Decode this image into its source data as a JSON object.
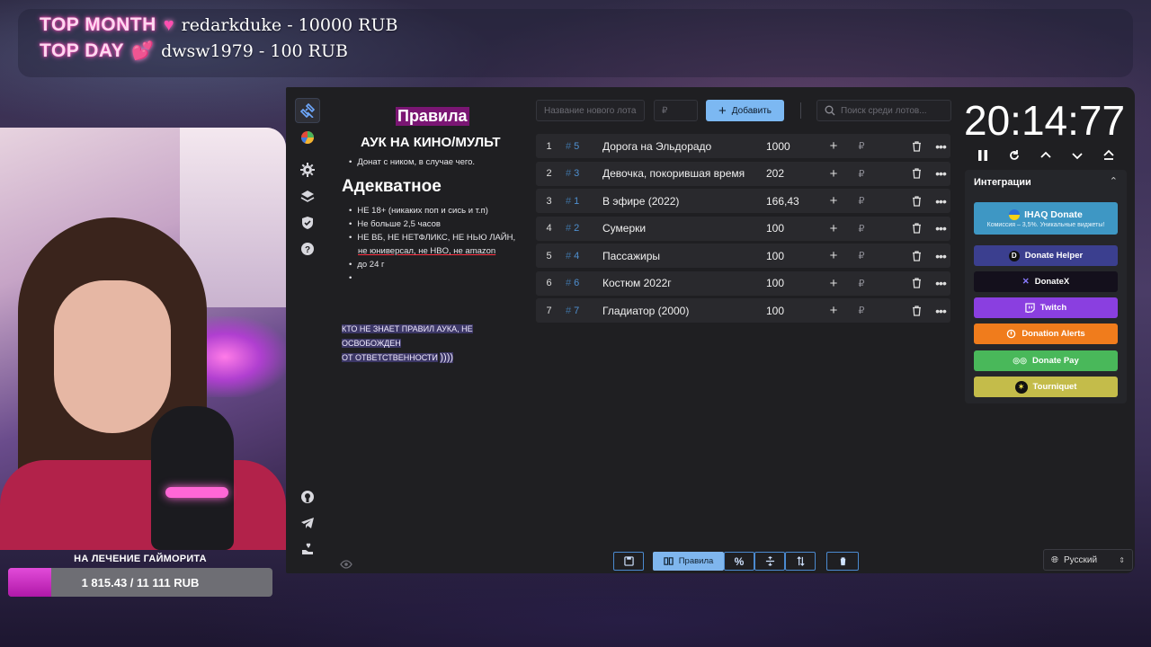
{
  "stream": {
    "top_month_tag": "TOP MONTH",
    "top_month_value": "redarkduke - 10000 RUB",
    "top_day_tag": "TOP DAY",
    "top_day_value": "dwsw1979 - 100 RUB",
    "goal_title": "НА ЛЕЧЕНИЕ ГАЙМОРИТА",
    "goal_text": "1 815.43 / 11 111 RUB",
    "goal_progress": 0.163
  },
  "rules": {
    "title": "Правила",
    "heading": "АУК НА КИНО/МУЛЬТ",
    "list1": [
      "Донат с ником, в случае чего."
    ],
    "heading2": "Адекватное",
    "list2": [
      "НЕ 18+ (никаких поп и сись и т.п)",
      "Не больше 2,5 часов",
      "НЕ ВБ, НЕ НЕТФЛИКС, НЕ НЬЮ ЛАЙН,",
      "не юниверсал, не HBO, не amazon",
      "до 24 г",
      ""
    ],
    "note_line1": "КТО НЕ ЗНАЕТ ПРАВИЛ АУКА, НЕ ОСВОБОЖДЕН",
    "note_line2": "ОТ ОТВЕТСТВЕННОСТИ",
    "note_suffix": "))))"
  },
  "toolbar": {
    "new_lot_placeholder": "Название нового лота",
    "amount_placeholder": "₽",
    "add_label": "Добавить",
    "search_placeholder": "Поиск среди лотов..."
  },
  "lots": [
    {
      "idx": "1",
      "id": "5",
      "name": "Дорога на Эльдорадо",
      "amount": "1000"
    },
    {
      "idx": "2",
      "id": "3",
      "name": "Девочка, покорившая время",
      "amount": "202"
    },
    {
      "idx": "3",
      "id": "1",
      "name": "В эфире (2022)",
      "amount": "166,43"
    },
    {
      "idx": "4",
      "id": "2",
      "name": "Сумерки",
      "amount": "100"
    },
    {
      "idx": "5",
      "id": "4",
      "name": "Пассажиры",
      "amount": "100"
    },
    {
      "idx": "6",
      "id": "6",
      "name": "Костюм 2022г",
      "amount": "100"
    },
    {
      "idx": "7",
      "id": "7",
      "name": "Гладиатор (2000)",
      "amount": "100"
    }
  ],
  "lot_currency": "₽",
  "timer": "20:14:77",
  "integrations": {
    "title": "Интеграции",
    "ihaq_label": "IHAQ Donate",
    "ihaq_sub": "Комиссия – 3,5%. Уникальные виджеты!",
    "buttons": [
      "Donate Helper",
      "DonateX",
      "Twitch",
      "Donation Alerts",
      "Donate Pay",
      "Tourniquet"
    ]
  },
  "bottom": {
    "rules_label": "Правила",
    "language": "Русский"
  },
  "colors": {
    "accent": "#7cb8f2",
    "ihaq": "#3e97c4",
    "donate_helper": "#3b3f8f",
    "donatex": "#14101c",
    "twitch": "#8a3fe0",
    "donation_alerts": "#f07c1c",
    "donate_pay": "#49b85a",
    "tourniquet": "#c4bc4a"
  }
}
